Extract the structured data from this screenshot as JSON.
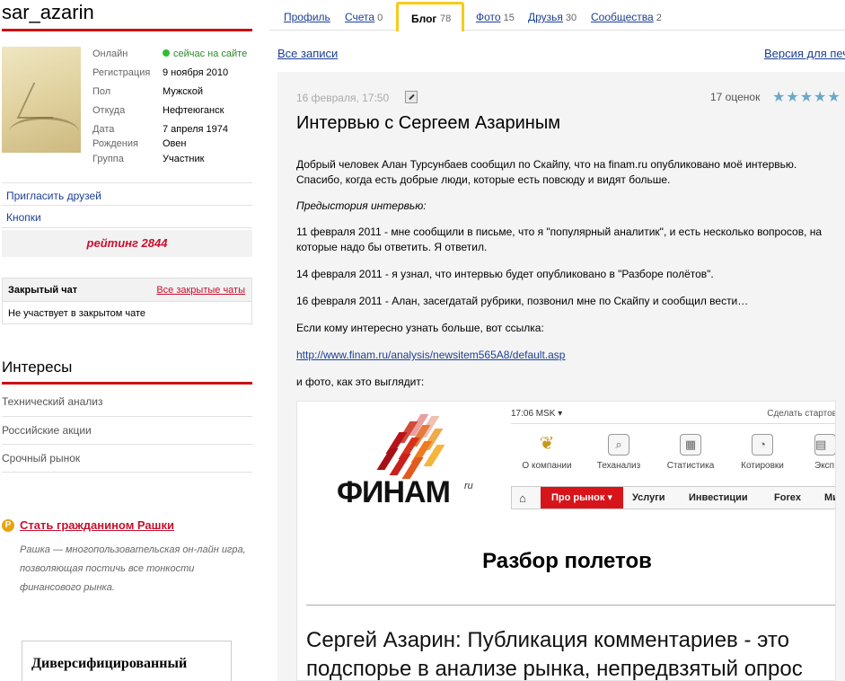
{
  "profile": {
    "username": "sar_azarin",
    "info": [
      {
        "key": "Онлайн",
        "value": "сейчас на сайте"
      },
      {
        "key": "Регистрация",
        "value": "9 ноября 2010"
      },
      {
        "key": "Пол",
        "value": "Мужской"
      },
      {
        "key": "Откуда",
        "value": "Нефтеюганск"
      },
      {
        "key": "Дата",
        "value": "7 апреля 1974"
      },
      {
        "key": "Рождения",
        "value": "Овен"
      },
      {
        "key": "Группа",
        "value": "Участник"
      }
    ],
    "invite_link": "Пригласить друзей",
    "buttons_link": "Кнопки",
    "rating": "рейтинг 2844"
  },
  "chat": {
    "title": "Закрытый чат",
    "all_link": "Все закрытые чаты",
    "status": "Не участвует в закрытом чате"
  },
  "interests": {
    "title": "Интересы",
    "items": [
      "Технический анализ",
      "Российские акции",
      "Срочный рынок"
    ]
  },
  "citizen": {
    "icon": "Р",
    "link": "Стать гражданином Рашки",
    "description": "Рашка — многопользовательская он-лайн игра, позволяющая постичь все тонкости финансового рынка."
  },
  "book": {
    "title": "Диверсифицированный"
  },
  "tabs": [
    {
      "label": "Профиль",
      "count": ""
    },
    {
      "label": "Счета",
      "count": "0"
    },
    {
      "label": "Блог",
      "count": "78",
      "active": true
    },
    {
      "label": "Фото",
      "count": "15"
    },
    {
      "label": "Друзья",
      "count": "30"
    },
    {
      "label": "Сообщества",
      "count": "2"
    }
  ],
  "blog": {
    "all_posts": "Все записи",
    "print_version": "Версия для печ",
    "date": "16 февраля, 17:50",
    "ratings": "17 оценок",
    "stars": "★★★★★",
    "title": "Интервью с Сергеем Азариным",
    "paragraphs": [
      "Добрый человек Алан Турсунбаев сообщил по Скайпу, что на finam.ru опубликовано моё интервью. Спасибо, когда есть добрые люди, которые есть повсюду и видят больше.",
      "Предыстория интервью:",
      "11 февраля 2011 - мне сообщили в письме, что я \"популярный аналитик\", и есть несколько вопросов, на которые надо бы ответить. Я ответил.",
      "14 февраля 2011 - я узнал, что интервью будет опубликовано в \"Разборе полётов\".",
      "16 февраля 2011 - Алан, засегдатай рубрики, позвонил мне по Скайпу и сообщил вести…",
      "Если кому интересно узнать больше, вот ссылка:",
      "и фото, как это выглядит:"
    ],
    "link": "http://www.finam.ru/analysis/newsitem565A8/default.asp"
  },
  "screenshot": {
    "logo": "ФИНАМ",
    "logo_sup": "ru",
    "time": "17:06 MSK ▾",
    "start_link": "Сделать стартов",
    "icons": [
      "О компании",
      "Теханализ",
      "Статистика",
      "Котировки",
      "Эксп"
    ],
    "nav_active": "Про рынок ▾",
    "nav": [
      "Услуги",
      "Инвестиции",
      "Forex",
      "Ми"
    ],
    "heading": "Разбор полетов",
    "article_line1": "Сергей Азарин: Публикация комментариев - это",
    "article_line2": "подспорье в анализе рынка, непредвзятый опрос"
  },
  "colors": {
    "accent_red": "#cc1111",
    "link_blue": "#1c3f94",
    "tab_gold": "#f5cc1d",
    "star_blue": "#6aa8c8"
  }
}
